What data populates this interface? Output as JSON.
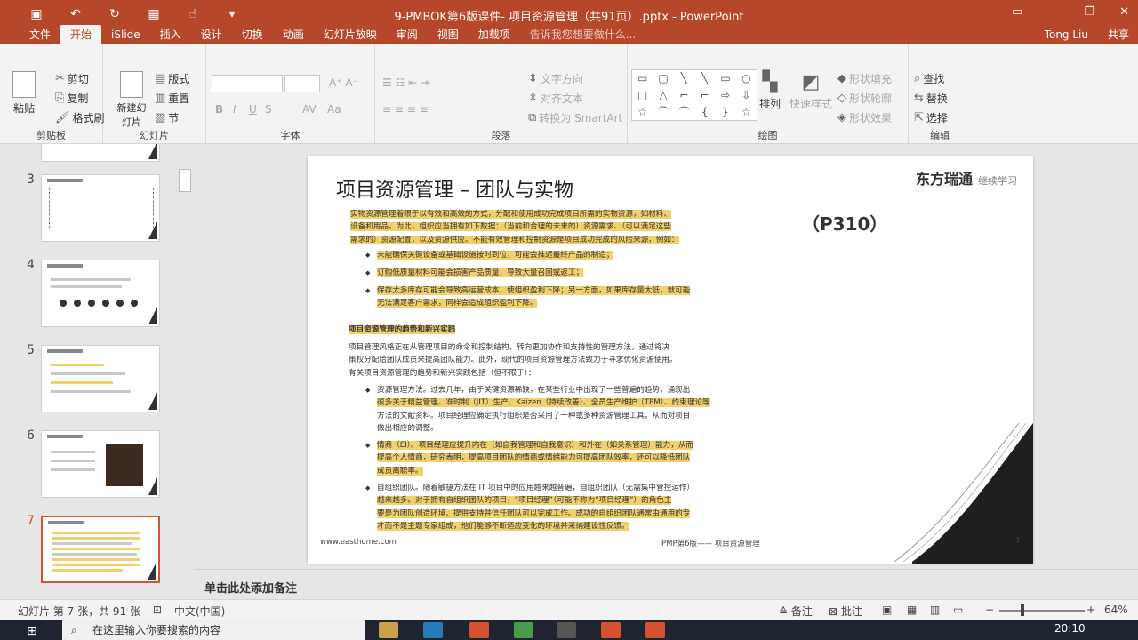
{
  "window": {
    "title": "9-PMBOK第6版课件- 项目资源管理（共91页）.pptx - PowerPoint",
    "user": "Tong Liu",
    "share": "共享"
  },
  "tabs": [
    {
      "label": "文件"
    },
    {
      "label": "开始"
    },
    {
      "label": "iSlide"
    },
    {
      "label": "插入"
    },
    {
      "label": "设计"
    },
    {
      "label": "切换"
    },
    {
      "label": "动画"
    },
    {
      "label": "幻灯片放映"
    },
    {
      "label": "审阅"
    },
    {
      "label": "视图"
    },
    {
      "label": "加载项"
    },
    {
      "label": "告诉我您想要做什么..."
    }
  ],
  "ribbon": {
    "clipboard": {
      "paste": "粘贴",
      "cut": "剪切",
      "copy": "复制",
      "format_painter": "格式刷",
      "label": "剪贴板"
    },
    "slides": {
      "new_slide": "新建幻灯片",
      "layout": "版式",
      "reset": "重置",
      "section": "节",
      "label": "幻灯片"
    },
    "font": {
      "label": "字体",
      "bold": "B",
      "italic": "I",
      "underline": "U",
      "strike": "S",
      "spacing": "AV",
      "case": "Aa"
    },
    "paragraph": {
      "text_direction": "文字方向",
      "align_text": "对齐文本",
      "smartart": "转换为 SmartArt",
      "label": "段落"
    },
    "drawing": {
      "arrange": "排列",
      "quick_styles": "快速样式",
      "fill": "形状填充",
      "outline": "形状轮廓",
      "effects": "形状效果",
      "label": "绘图"
    },
    "editing": {
      "find": "查找",
      "replace": "替换",
      "select": "选择",
      "label": "编辑"
    }
  },
  "thumbnails": [
    {
      "num": "3"
    },
    {
      "num": "4"
    },
    {
      "num": "5"
    },
    {
      "num": "6"
    },
    {
      "num": "7"
    }
  ],
  "slide": {
    "title": "项目资源管理 – 团队与实物",
    "logo": "东方瑞通",
    "logo_sub": "继续学习",
    "page_ref": "（P310）",
    "intro_1": "实物资源管理着眼于以有效和高效的方式，分配和使用成功完成项目所需的实物资源，如材料、",
    "intro_2": "设备和用品。为此，组织应当拥有如下数据：（当前和合理的未来的）资源需求、（可以满足这些",
    "intro_3": "需求的）资源配置，以及资源供应。不能有效管理和控制资源是项目成功完成的风险来源，例如：",
    "bullet_1": "未能确保关键设备或基础设施按时到位，可能会推迟最终产品的制造；",
    "bullet_2": "订购低质量材料可能会损害产品质量，导致大量召回或返工；",
    "bullet_3a": "保存太多库存可能会导致高运营成本，使组织盈利下降；另一方面，如果库存量太低，就可能",
    "bullet_3b": "无法满足客户需求，同样会造成组织盈利下降。",
    "section_heading": "项目资源管理的趋势和新兴实践",
    "trend_1": "项目管理风格正在从管理项目的命令和控制结构，转向更加协作和支持性的管理方法，通过将决",
    "trend_2": "策权分配给团队成员来提高团队能力。此外，现代的项目资源管理方法致力于寻求优化资源使用。",
    "trend_3": "有关项目资源管理的趋势和新兴实践包括（但不限于）：",
    "t1_1": "资源管理方法。过去几年，由于关键资源稀缺，在某些行业中出现了一些普遍的趋势，涌现出",
    "t1_2": "很多关于精益管理、准时制（JIT）生产、Kaizen（持续改善）、全员生产维护（TPM）、约束理论等",
    "t1_3": "方法的文献资料。项目经理应确定执行组织是否采用了一种或多种资源管理工具，从而对项目",
    "t1_4": "做出相应的调整。",
    "t2_1": "情商（EI）。项目经理应提升内在（如自我管理和自我意识）和外在（如关系管理）能力，从而",
    "t2_2": "提高个人情商，研究表明，提高项目团队的情商或情绪能力可提高团队效率，还可以降低团队",
    "t2_3": "成员离职率。",
    "t3_1": "自组织团队。随着敏捷方法在 IT 项目中的应用越来越普遍，自组织团队（无需集中管控运作）",
    "t3_2": "越来越多。对于拥有自组织团队的项目，“项目经理”（可能不称为“项目经理”）的角色主",
    "t3_3": "要是为团队创造环境、提供支持并信任团队可以完成工作。成功的自组织团队通常由通用的专",
    "t3_4": "才而不是主题专家组成，他们能够不断适应变化的环境并采纳建设性反馈。",
    "footer_left": "www.easthome.com",
    "footer_right": "PMP第6版—— 项目资源管理",
    "number": "7"
  },
  "notes_placeholder": "单击此处添加备注",
  "status": {
    "slide_info": "幻灯片 第 7 张，共 91 张",
    "language": "中文(中国)",
    "notes": "备注",
    "comments": "批注",
    "zoom": "64%"
  },
  "taskbar": {
    "search_placeholder": "在这里输入你要搜索的内容",
    "time": "20:10"
  }
}
